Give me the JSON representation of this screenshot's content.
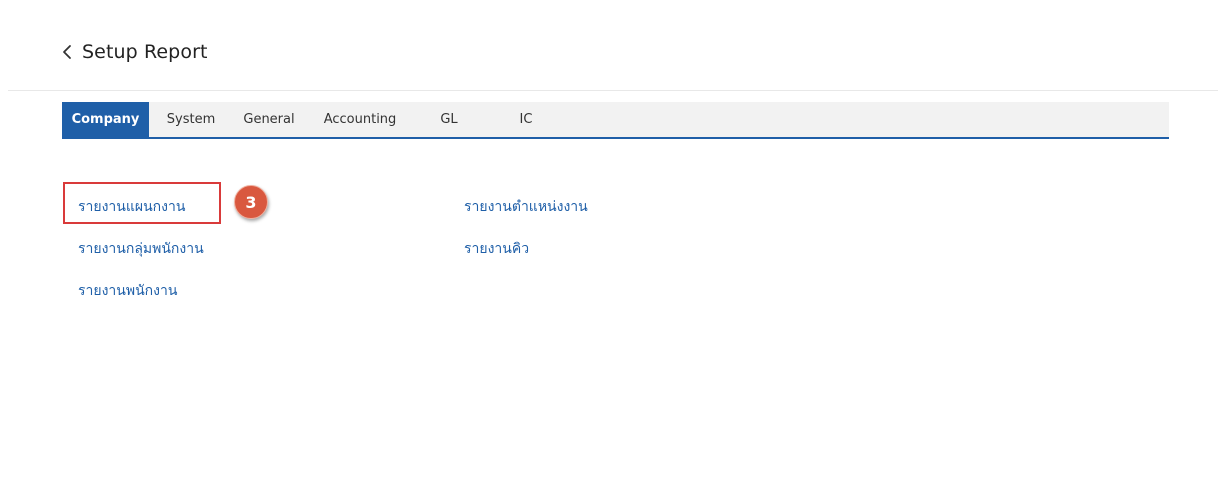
{
  "header": {
    "back_icon": "chevron-left-icon",
    "title": "Setup Report"
  },
  "tabs": {
    "active": "Company",
    "items": [
      {
        "label": "Company"
      },
      {
        "label": "System"
      },
      {
        "label": "General"
      },
      {
        "label": "Accounting"
      },
      {
        "label": "GL"
      },
      {
        "label": "IC"
      }
    ]
  },
  "reports": {
    "left_column": [
      {
        "label": "รายงานแผนกงาน"
      },
      {
        "label": "รายงานกลุ่มพนักงาน"
      },
      {
        "label": "รายงานพนักงาน"
      }
    ],
    "right_column": [
      {
        "label": "รายงานตำแหน่งงาน"
      },
      {
        "label": "รายงานคิว"
      }
    ]
  },
  "annotation": {
    "step_number": "3",
    "highlight_color": "#d93a3a",
    "badge_color": "#d9583f"
  },
  "colors": {
    "accent": "#1f5fa8",
    "tabbar_bg": "#f2f2f2",
    "link": "#1f5fa8"
  }
}
